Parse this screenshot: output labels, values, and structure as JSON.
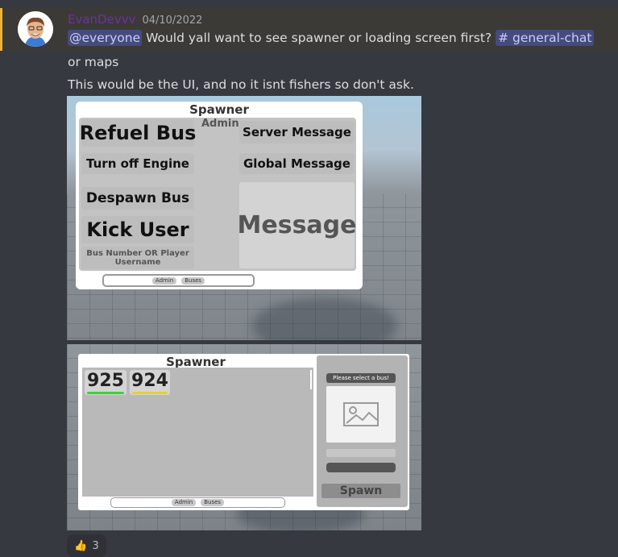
{
  "message": {
    "username": "EvanDevvv",
    "timestamp": "04/10/2022",
    "mention": "@everyone",
    "text1": " Would yall want to see spawner or loading screen first? ",
    "channel_hash": "#",
    "channel": "general-chat",
    "line2": "or maps",
    "line3": "This would be the UI, and no it isnt fishers so don't ask."
  },
  "admin_panel": {
    "title": "Spawner",
    "admin_tag": "Admin",
    "buttons": [
      "Refuel Bus",
      "Turn off Engine",
      "Despawn Bus",
      "Kick User",
      "Server Message",
      "Global Message"
    ],
    "input_placeholder": "Bus Number OR Player Username",
    "message_box": "Message",
    "tabs": [
      "Admin",
      "Buses"
    ]
  },
  "bus_panel": {
    "title": "Spawner",
    "buses": [
      {
        "number": "925",
        "color": "#3dd13d"
      },
      {
        "number": "924",
        "color": "#e2d23a"
      }
    ],
    "select_label": "Please select a bus!",
    "spawn_button": "Spawn",
    "tabs": [
      "Admin",
      "Buses"
    ]
  },
  "reaction": {
    "emoji": "👍",
    "count": "3"
  },
  "colors": {
    "mention_bg": "#454b7c",
    "highlight_border": "#f0b232",
    "username": "#6e2fa8"
  }
}
